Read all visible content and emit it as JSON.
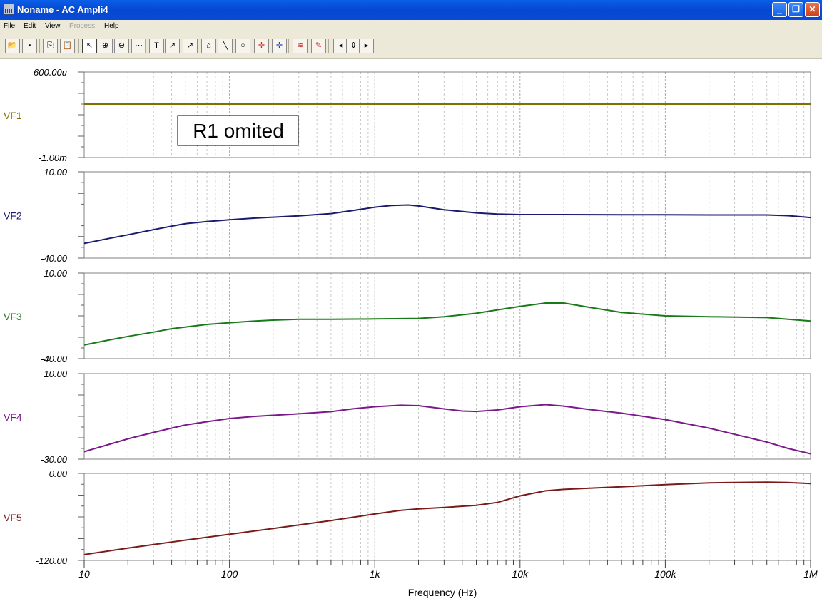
{
  "window": {
    "title": "Noname - AC Ampli4",
    "controls": {
      "minimize": "_",
      "maximize": "❐",
      "close": "✕"
    }
  },
  "menu": {
    "items": [
      {
        "label": "File",
        "enabled": true
      },
      {
        "label": "Edit",
        "enabled": true
      },
      {
        "label": "View",
        "enabled": true
      },
      {
        "label": "Process",
        "enabled": false
      },
      {
        "label": "Help",
        "enabled": true
      }
    ]
  },
  "toolbar": {
    "tools": [
      {
        "name": "open-icon",
        "glyph": "📂"
      },
      {
        "name": "save-icon",
        "glyph": "▪"
      },
      {
        "name": "copy-icon",
        "glyph": "⎘"
      },
      {
        "name": "paste-icon",
        "glyph": "📋"
      },
      {
        "name": "pointer-icon",
        "glyph": "↖"
      },
      {
        "name": "zoom-in-icon",
        "glyph": "⊕"
      },
      {
        "name": "zoom-100-icon",
        "glyph": "⊖"
      },
      {
        "name": "grid-icon",
        "glyph": "⋯"
      },
      {
        "name": "text-icon",
        "glyph": "T"
      },
      {
        "name": "marker-a-icon",
        "glyph": "↗"
      },
      {
        "name": "marker-b-icon",
        "glyph": "↗"
      },
      {
        "name": "marker-c-icon",
        "glyph": "⌂"
      },
      {
        "name": "line-icon",
        "glyph": "╲"
      },
      {
        "name": "circle-icon",
        "glyph": "○"
      },
      {
        "name": "cursor-a-icon",
        "glyph": "✛"
      },
      {
        "name": "cursor-b-icon",
        "glyph": "✛"
      },
      {
        "name": "curves-icon",
        "glyph": "≋"
      },
      {
        "name": "probe-icon",
        "glyph": "✎"
      },
      {
        "name": "step-left-icon",
        "glyph": "◂"
      },
      {
        "name": "step-updown-icon",
        "glyph": "⇕"
      },
      {
        "name": "step-right-icon",
        "glyph": "▸"
      }
    ]
  },
  "chart_data": {
    "type": "line",
    "xlabel": "Frequency (Hz)",
    "xscale": "log",
    "xlim": [
      10,
      1000000
    ],
    "xticks": [
      {
        "value": 10,
        "label": "10"
      },
      {
        "value": 100,
        "label": "100"
      },
      {
        "value": 1000,
        "label": "1k"
      },
      {
        "value": 10000,
        "label": "10k"
      },
      {
        "value": 100000,
        "label": "100k"
      },
      {
        "value": 1000000,
        "label": "1M"
      }
    ],
    "grid": true,
    "annotation": {
      "text": "R1 omited",
      "panel": "VF1"
    },
    "panels": [
      {
        "name": "VF1",
        "color": "#807000",
        "ylim": [
          -0.001,
          0.0006
        ],
        "ytop_label": "600.00u",
        "ybottom_label": "-1.00m",
        "x": [
          10,
          1000000
        ],
        "y": [
          0.0,
          0.0
        ]
      },
      {
        "name": "VF2",
        "color": "#1a1a6e",
        "ylim": [
          -40,
          10
        ],
        "ytop_label": "10.00",
        "ybottom_label": "-40.00",
        "x": [
          10,
          15,
          20,
          30,
          40,
          50,
          70,
          100,
          150,
          200,
          300,
          500,
          700,
          1000,
          1300,
          1700,
          2000,
          3000,
          5000,
          7000,
          10000,
          20000,
          50000,
          100000,
          200000,
          500000,
          700000,
          1000000
        ],
        "y": [
          -31.5,
          -28.5,
          -26.5,
          -23.5,
          -21.5,
          -20.0,
          -18.8,
          -17.8,
          -16.8,
          -16.3,
          -15.5,
          -14.2,
          -12.5,
          -10.5,
          -9.5,
          -9.2,
          -9.8,
          -12.0,
          -13.8,
          -14.5,
          -14.8,
          -14.8,
          -14.9,
          -14.9,
          -15.0,
          -15.0,
          -15.4,
          -16.5
        ]
      },
      {
        "name": "VF3",
        "color": "#1a7a1a",
        "ylim": [
          -40,
          10
        ],
        "ytop_label": "10.00",
        "ybottom_label": "-40.00",
        "x": [
          10,
          15,
          20,
          30,
          40,
          50,
          70,
          100,
          150,
          200,
          300,
          500,
          1000,
          2000,
          3000,
          5000,
          7000,
          10000,
          15000,
          20000,
          30000,
          50000,
          100000,
          200000,
          500000,
          1000000
        ],
        "y": [
          -32.0,
          -29.0,
          -27.0,
          -24.5,
          -22.5,
          -21.5,
          -20.0,
          -19.0,
          -18.0,
          -17.5,
          -17.0,
          -17.0,
          -16.8,
          -16.5,
          -15.5,
          -13.5,
          -11.5,
          -9.5,
          -7.5,
          -7.5,
          -10.0,
          -13.0,
          -15.0,
          -15.5,
          -16.0,
          -18.0
        ]
      },
      {
        "name": "VF4",
        "color": "#7a1a8a",
        "ylim": [
          -30,
          10
        ],
        "ytop_label": "10.00",
        "ybottom_label": "-30.00",
        "x": [
          10,
          15,
          20,
          30,
          40,
          50,
          70,
          100,
          150,
          200,
          300,
          500,
          700,
          1000,
          1500,
          2000,
          3000,
          4000,
          5000,
          7000,
          10000,
          15000,
          20000,
          30000,
          50000,
          100000,
          200000,
          500000,
          700000,
          1000000
        ],
        "y": [
          -26.5,
          -23.0,
          -20.5,
          -17.5,
          -15.5,
          -14.0,
          -12.5,
          -11.0,
          -10.0,
          -9.5,
          -8.8,
          -7.8,
          -6.5,
          -5.5,
          -4.8,
          -5.0,
          -6.5,
          -7.5,
          -7.7,
          -7.0,
          -5.5,
          -4.5,
          -5.2,
          -6.8,
          -8.5,
          -11.5,
          -15.5,
          -22.0,
          -25.0,
          -27.5
        ]
      },
      {
        "name": "VF5",
        "color": "#7a1a1a",
        "ylim": [
          -120,
          0
        ],
        "ytop_label": "0.00",
        "ybottom_label": "-120.00",
        "x": [
          10,
          20,
          50,
          100,
          200,
          500,
          1000,
          1500,
          2000,
          3000,
          5000,
          7000,
          10000,
          15000,
          20000,
          30000,
          50000,
          100000,
          200000,
          500000,
          700000,
          1000000
        ],
        "y": [
          -112.0,
          -103.0,
          -92.0,
          -84.0,
          -76.0,
          -65.0,
          -56.0,
          -51.0,
          -49.0,
          -47.0,
          -44.0,
          -40.0,
          -31.0,
          -24.0,
          -22.0,
          -20.5,
          -18.5,
          -15.5,
          -13.0,
          -12.0,
          -12.5,
          -14.0
        ]
      }
    ]
  }
}
